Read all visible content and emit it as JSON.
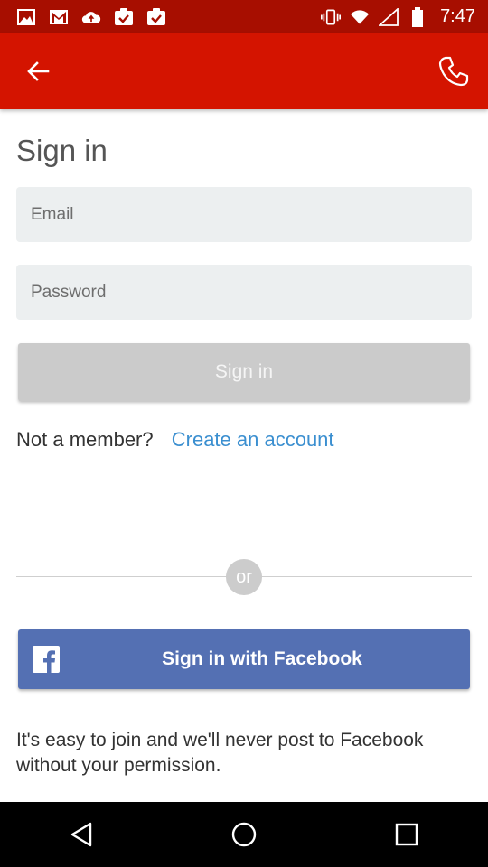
{
  "status_bar": {
    "time": "7:47",
    "left_icons": [
      "image-icon",
      "gmail-icon",
      "cloud-upload-icon",
      "clipboard-check-icon",
      "clipboard-check-icon"
    ],
    "right_icons": [
      "vibrate-icon",
      "wifi-icon",
      "signal-icon",
      "battery-icon"
    ]
  },
  "app_bar": {
    "back_icon": "arrow-left-icon",
    "call_icon": "phone-icon",
    "color": "#d41400"
  },
  "page": {
    "title": "Sign in",
    "email_placeholder": "Email",
    "password_placeholder": "Password",
    "signin_button": "Sign in",
    "not_member_text": "Not a member?",
    "create_account_link": "Create an account",
    "or_text": "or",
    "facebook_button": "Sign in with Facebook",
    "footnote": "It's easy to join and we'll never post to Facebook without your permission."
  },
  "colors": {
    "accent": "#d41400",
    "link": "#3b8fd0",
    "facebook": "#5470b3",
    "disabled_button": "#cbcbcb"
  },
  "nav_bar": {
    "icons": [
      "back-triangle-icon",
      "home-circle-icon",
      "recents-square-icon"
    ]
  }
}
